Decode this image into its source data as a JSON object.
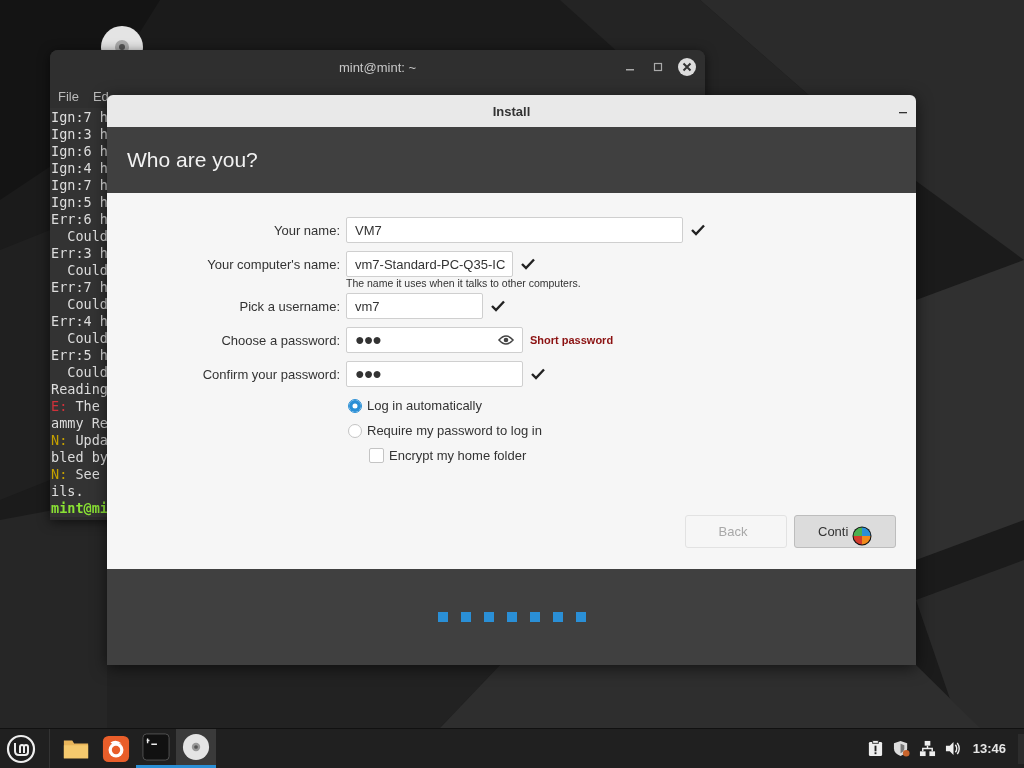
{
  "terminal": {
    "title": "mint@mint: ~",
    "menu": [
      "File",
      "Ed"
    ],
    "lines": [
      {
        "kind": "plain",
        "text": "Ign:7 h"
      },
      {
        "kind": "plain",
        "text": "Ign:3 h"
      },
      {
        "kind": "plain",
        "text": "Ign:6 h"
      },
      {
        "kind": "plain",
        "text": "Ign:4 h"
      },
      {
        "kind": "plain",
        "text": "Ign:7 h"
      },
      {
        "kind": "plain",
        "text": "Ign:5 h"
      },
      {
        "kind": "plain",
        "text": "Err:6 h"
      },
      {
        "kind": "plain",
        "text": "  Could"
      },
      {
        "kind": "plain",
        "text": "Err:3 h"
      },
      {
        "kind": "plain",
        "text": "  Could"
      },
      {
        "kind": "plain",
        "text": "Err:7 h"
      },
      {
        "kind": "plain",
        "text": "  Could"
      },
      {
        "kind": "plain",
        "text": "Err:4 h"
      },
      {
        "kind": "plain",
        "text": "  Could"
      },
      {
        "kind": "plain",
        "text": "Err:5 h"
      },
      {
        "kind": "plain",
        "text": "  Could"
      },
      {
        "kind": "plain",
        "text": "Reading"
      },
      {
        "kind": "error",
        "prefix": "E:",
        "text": "The"
      },
      {
        "kind": "plain",
        "text": "ammy Re"
      },
      {
        "kind": "notice",
        "prefix": "N:",
        "text": "Upda"
      },
      {
        "kind": "plain",
        "text": "bled by"
      },
      {
        "kind": "notice",
        "prefix": "N:",
        "text": "See"
      },
      {
        "kind": "plain",
        "text": "ils."
      },
      {
        "kind": "prompt",
        "text": "mint@mi"
      }
    ]
  },
  "install": {
    "title": "Install",
    "heading": "Who are you?",
    "fields": [
      {
        "kind": "text",
        "label": "Your name:",
        "value": "VM7",
        "valid": true
      },
      {
        "kind": "text",
        "label": "Your computer's name:",
        "value": "vm7-Standard-PC-Q35-IC",
        "valid": true,
        "hint": "The name it uses when it talks to other computers."
      },
      {
        "kind": "text",
        "label": "Pick a username:",
        "value": "vm7",
        "valid": true
      },
      {
        "kind": "password",
        "label": "Choose a password:",
        "value": "●●●",
        "valid": false,
        "reveal": true,
        "message": "Short password"
      },
      {
        "kind": "password",
        "label": "Confirm your password:",
        "value": "●●●",
        "valid": true
      }
    ],
    "login_options": [
      {
        "label": "Log in automatically",
        "selected": true
      },
      {
        "label": "Require my password to log in",
        "selected": false
      }
    ],
    "encrypt": {
      "label": "Encrypt my home folder",
      "checked": false
    },
    "buttons": [
      {
        "label": "Back",
        "disabled": true
      },
      {
        "label": "Conti",
        "disabled": false
      }
    ]
  },
  "taskbar": {
    "launchers": [
      {
        "kind": "folder",
        "running": false,
        "active": false
      },
      {
        "kind": "browser",
        "running": false,
        "active": false
      },
      {
        "kind": "terminal",
        "running": true,
        "active": false
      },
      {
        "kind": "disc",
        "running": true,
        "active": true
      }
    ],
    "clock": "13:46"
  }
}
